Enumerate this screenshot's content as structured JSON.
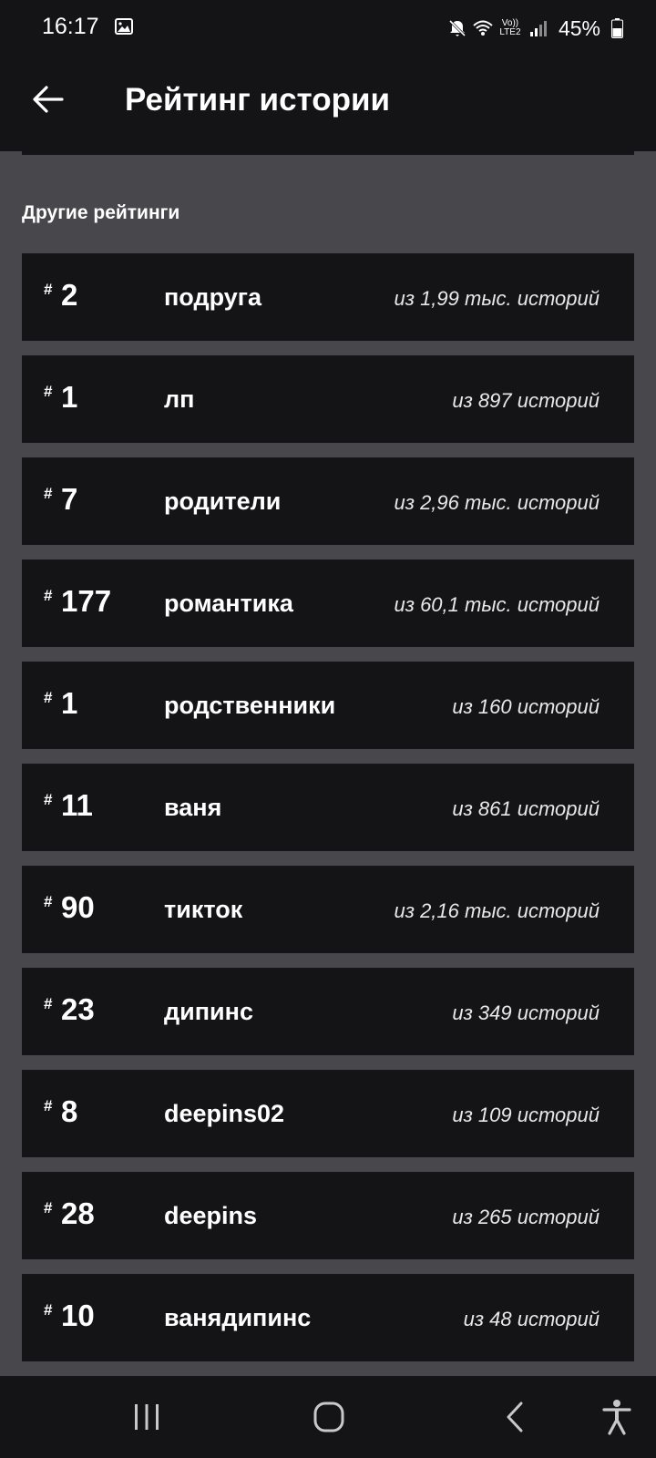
{
  "status_bar": {
    "time": "16:17",
    "volte_line1": "Vo))",
    "volte_line2": "LTE2",
    "battery": "45%",
    "icons": [
      "gallery-icon",
      "mute-icon",
      "wifi-icon",
      "volte-icon",
      "signal-icon",
      "battery-icon"
    ]
  },
  "app_bar": {
    "title": "Рейтинг истории",
    "back_icon": "arrow-left-icon"
  },
  "section": {
    "title": "Другие рейтинги"
  },
  "rankings": [
    {
      "hash": "#",
      "rank": "2",
      "tag": "подруга",
      "count": "из 1,99 тыс. историй"
    },
    {
      "hash": "#",
      "rank": "1",
      "tag": "лп",
      "count": "из 897 историй"
    },
    {
      "hash": "#",
      "rank": "7",
      "tag": "родители",
      "count": "из 2,96 тыс. историй"
    },
    {
      "hash": "#",
      "rank": "177",
      "tag": "романтика",
      "count": "из 60,1 тыс. историй"
    },
    {
      "hash": "#",
      "rank": "1",
      "tag": "родственники",
      "count": "из 160 историй"
    },
    {
      "hash": "#",
      "rank": "11",
      "tag": "ваня",
      "count": "из 861 историй"
    },
    {
      "hash": "#",
      "rank": "90",
      "tag": "тикток",
      "count": "из 2,16 тыс. историй"
    },
    {
      "hash": "#",
      "rank": "23",
      "tag": "дипинс",
      "count": "из 349 историй"
    },
    {
      "hash": "#",
      "rank": "8",
      "tag": "deepins02",
      "count": "из 109 историй"
    },
    {
      "hash": "#",
      "rank": "28",
      "tag": "deepins",
      "count": "из 265 историй"
    },
    {
      "hash": "#",
      "rank": "10",
      "tag": "ванядипинс",
      "count": "из 48 историй"
    }
  ],
  "nav_bar": {
    "icons": [
      "recent-apps-icon",
      "home-icon",
      "back-icon",
      "accessibility-icon"
    ]
  },
  "colors": {
    "background": "#48474b",
    "card": "#141316",
    "text": "#ffffff"
  }
}
